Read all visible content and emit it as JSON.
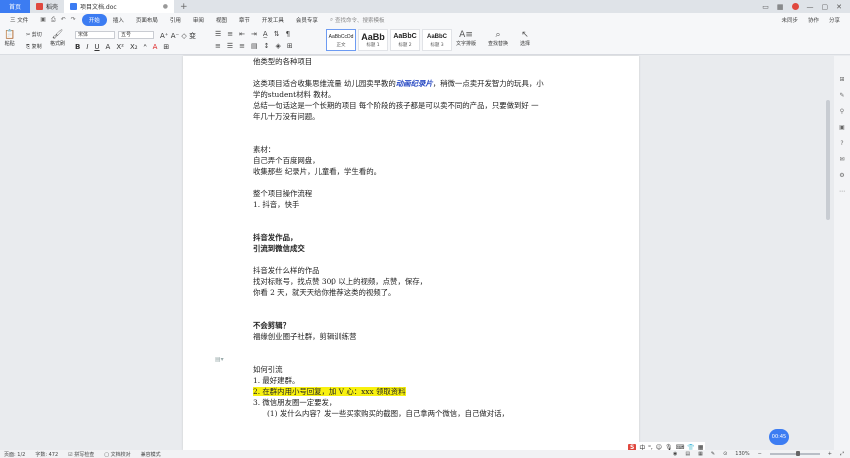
{
  "titlebar": {
    "home": "首页",
    "tabs": [
      {
        "label": "稻壳"
      },
      {
        "label": "项目文档.doc"
      }
    ],
    "add": "+"
  },
  "menubar": {
    "file": "三 文件",
    "items": [
      "开始",
      "插入",
      "页面布局",
      "引用",
      "审阅",
      "视图",
      "章节",
      "开发工具",
      "会员专享"
    ],
    "search": "查找命令、搜索模板",
    "right": [
      "未同步",
      "协作",
      "分享"
    ]
  },
  "ribbon": {
    "paste": "粘贴",
    "cut": "剪切",
    "copy": "复制",
    "format_brush": "格式刷",
    "font": "宋体",
    "size": "五号",
    "styles": [
      {
        "preview": "AaBbCcDd",
        "name": "正文"
      },
      {
        "preview": "AaBb",
        "name": "标题 1"
      },
      {
        "preview": "AaBbC",
        "name": "标题 2"
      },
      {
        "preview": "AaBbC",
        "name": "标题 3"
      }
    ],
    "text_layout": "文字排版",
    "find_replace": "查找替换",
    "select": "选择"
  },
  "doc": {
    "l1": "他类型的各种项目",
    "l2a": "这类项目适合收集思维流量 幼儿园卖早教的",
    "l2b": "动画纪录片",
    "l2c": "，稍微一点卖开发智力的玩具，小",
    "l3": "学的student材料 教材。",
    "l4": "总结一句话这是一个长期的项目   每个阶段的孩子都是可以卖不同的产品，只要做到好  一",
    "l5": "年几十万没有问题。",
    "l6": "素材：",
    "l7": "自己弄个百度网盘，",
    "l8": "收集那些 纪录片，儿童看，学生看的。",
    "l9": "整个项目操作流程",
    "l10": "1.  抖音，快手",
    "l11": "抖音发作品，",
    "l12": "引流到微信成交",
    "l13": "抖音发什么样的作品",
    "l14": "找对标账号，找点赞 300 以上的视频，点赞，保存，",
    "l15": "你看 2 天，就天天给你推荐这类的视频了。",
    "l16": "不会剪辑？",
    "l17": "福缘创业圈子社群，剪辑训练营",
    "l18": "如何引流",
    "l19": "1.  最好建群。",
    "l20": "2.  在群内用小号回复，加 V 心：xxx   领取资料",
    "l21": "3.  微信朋友圈一定要发，",
    "l22": "(1)   发什么内容？发一些买家购买的截图，自己拿两个微信，自己做对话，"
  },
  "timer": "00:45",
  "statusbar": {
    "page": "页面: 1/2",
    "words": "字数: 472",
    "spell": "拼写检查",
    "proof": "文档校对",
    "compat": "兼容模式",
    "zoom": "130%"
  },
  "ime": {
    "logo": "S",
    "lang": "中"
  }
}
